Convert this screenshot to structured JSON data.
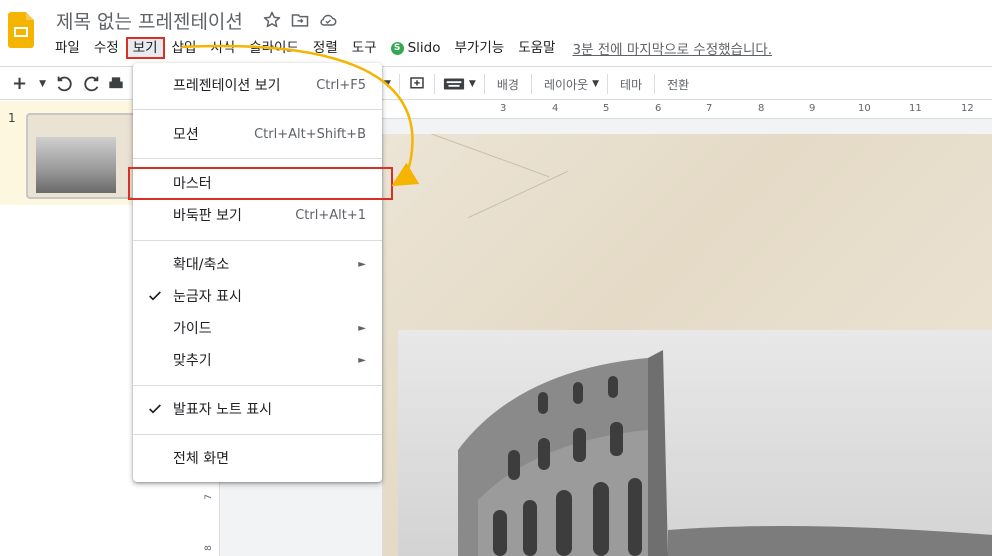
{
  "header": {
    "doc_title": "제목 없는 프레젠테이션",
    "icons": [
      "star-icon",
      "folder-move-icon",
      "cloud-status-icon"
    ]
  },
  "menubar": {
    "items": [
      {
        "label": "파일"
      },
      {
        "label": "수정"
      },
      {
        "label": "보기"
      },
      {
        "label": "삽입"
      },
      {
        "label": "서식"
      },
      {
        "label": "슬라이드"
      },
      {
        "label": "정렬"
      },
      {
        "label": "도구"
      },
      {
        "label": "Slido"
      },
      {
        "label": "부가기능"
      },
      {
        "label": "도움말"
      }
    ],
    "last_edit": "3분 전에 마지막으로 수정했습니다."
  },
  "toolbar": {
    "add": "+",
    "background": "배경",
    "layout": "레이아웃",
    "theme": "테마",
    "transition": "전환"
  },
  "filmstrip": {
    "slide_number": "1"
  },
  "ruler": {
    "h_ticks": [
      "3",
      "4",
      "5",
      "6",
      "7",
      "8",
      "9",
      "10",
      "11",
      "12"
    ],
    "v_ticks": [
      "7",
      "8"
    ]
  },
  "view_menu": {
    "items": [
      {
        "label": "프레젠테이션 보기",
        "shortcut": "Ctrl+F5"
      },
      {
        "label": "모션",
        "shortcut": "Ctrl+Alt+Shift+B"
      },
      {
        "label": "마스터",
        "shortcut": ""
      },
      {
        "label": "바둑판 보기",
        "shortcut": "Ctrl+Alt+1"
      },
      {
        "label": "확대/축소",
        "shortcut": ""
      },
      {
        "label": "눈금자 표시",
        "shortcut": ""
      },
      {
        "label": "가이드",
        "shortcut": ""
      },
      {
        "label": "맞추기",
        "shortcut": ""
      },
      {
        "label": "발표자 노트 표시",
        "shortcut": ""
      },
      {
        "label": "전체 화면",
        "shortcut": ""
      }
    ]
  },
  "colors": {
    "annotation_red": "#d93025",
    "annotation_arrow": "#f4b400",
    "slides_brand": "#f4b400",
    "slido_green": "#34a853"
  }
}
